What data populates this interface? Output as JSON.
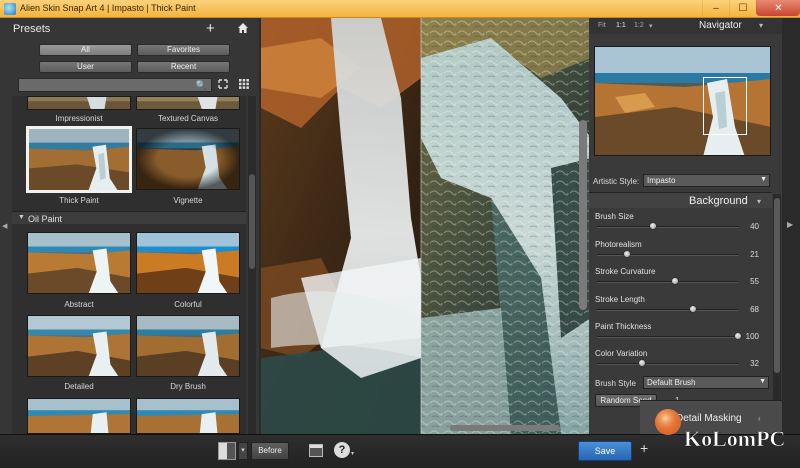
{
  "window": {
    "title": "Alien Skin Snap Art 4 | Impasto | Thick Paint",
    "minimize_label": "–",
    "maximize_label": "☐",
    "close_label": "✕"
  },
  "presets": {
    "header": "Presets",
    "add_label": "+",
    "filters": [
      {
        "label": "All",
        "active": true
      },
      {
        "label": "Favorites",
        "active": false
      },
      {
        "label": "User",
        "active": false
      },
      {
        "label": "Recent",
        "active": false
      }
    ],
    "search_placeholder": "",
    "search_icon": "🔍",
    "items_top": [
      {
        "label": "Impressionist"
      },
      {
        "label": "Textured Canvas"
      },
      {
        "label": "Thick Paint",
        "selected": true
      },
      {
        "label": "Vignette"
      }
    ],
    "oil_section": {
      "label": "Oil Paint",
      "collapse_glyph": "▼"
    },
    "items_oil": [
      {
        "label": "Abstract"
      },
      {
        "label": "Colorful"
      },
      {
        "label": "Detailed"
      },
      {
        "label": "Dry Brush"
      }
    ]
  },
  "navigator": {
    "zoom_options": [
      {
        "label": "Fit"
      },
      {
        "label": "1:1"
      },
      {
        "label": "1:2"
      }
    ],
    "zoom_drop": "▾",
    "title": "Navigator",
    "collapse": "▾"
  },
  "settings": {
    "artistic_style_label": "Artistic Style:",
    "artistic_style_value": "Impasto",
    "section_title": "Background",
    "section_collapse": "▾",
    "params": [
      {
        "label": "Brush Size",
        "value": "40",
        "level": 0.4
      },
      {
        "label": "Photorealism",
        "value": "21",
        "level": 0.21
      },
      {
        "label": "Stroke Curvature",
        "value": "55",
        "level": 0.55
      },
      {
        "label": "Stroke Length",
        "value": "68",
        "level": 0.68
      },
      {
        "label": "Paint Thickness",
        "value": "100",
        "level": 1.0
      },
      {
        "label": "Color Variation",
        "value": "32",
        "level": 0.32
      }
    ],
    "brush_style_label": "Brush Style",
    "brush_style_value": "Default Brush",
    "random_seed_label": "Random Seed",
    "random_seed_value": "1",
    "dropdown_arrow": "▼"
  },
  "detail_masking": {
    "label": "Detail Masking",
    "collapse": "‹"
  },
  "bottombar": {
    "compare_drop": "▾",
    "before_label": "Before",
    "help_label": "?",
    "help_drop": "▾",
    "save_label": "Save",
    "plus_label": "+"
  },
  "side_arrows": {
    "left": "◀",
    "right": "▶"
  },
  "watermark": {
    "text": "KoLomPC"
  },
  "colors": {
    "accent_save": "#2f74c4",
    "titlebar": "#f6c25a",
    "panel": "#363636"
  }
}
